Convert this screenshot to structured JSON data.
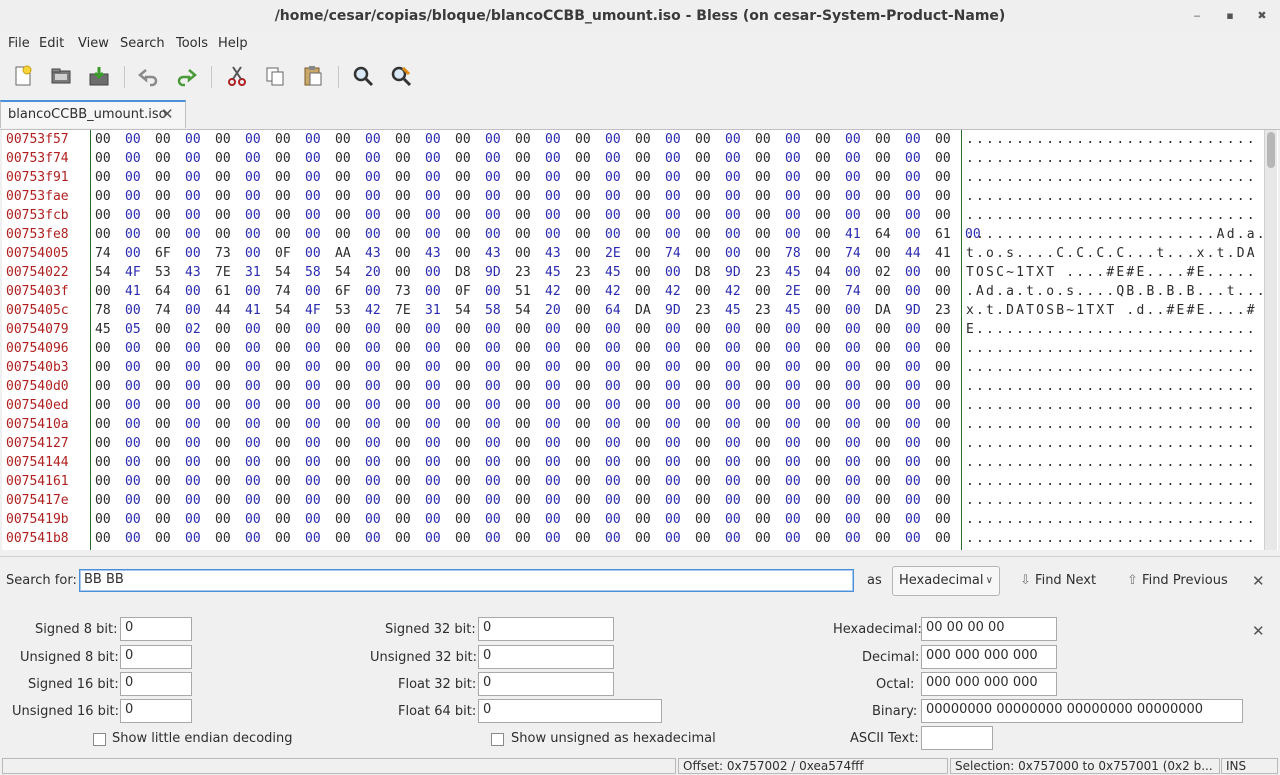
{
  "window": {
    "title": "/home/cesar/copias/bloque/blancoCCBB_umount.iso - Bless (on cesar-System-Product-Name)"
  },
  "menu": [
    "File",
    "Edit",
    "View",
    "Search",
    "Tools",
    "Help"
  ],
  "toolbar": {
    "icons": [
      "new-file-icon",
      "open-folder-icon",
      "save-icon",
      "undo-icon",
      "redo-icon",
      "cut-icon",
      "copy-icon",
      "paste-icon",
      "find-icon",
      "find-replace-icon"
    ]
  },
  "tab": {
    "label": "blancoCCBB_umount.iso"
  },
  "hex": {
    "offsets": [
      "00753f57",
      "00753f74",
      "00753f91",
      "00753fae",
      "00753fcb",
      "00753fe8",
      "00754005",
      "00754022",
      "0075403f",
      "0075405c",
      "00754079",
      "00754096",
      "007540b3",
      "007540d0",
      "007540ed",
      "0075410a",
      "00754127",
      "00754144",
      "00754161",
      "0075417e",
      "0075419b",
      "007541b8"
    ],
    "rows": [
      "00 00 00 00 00 00 00 00 00 00 00 00 00 00 00 00 00 00 00 00 00 00 00 00 00 00 00 00 00",
      "00 00 00 00 00 00 00 00 00 00 00 00 00 00 00 00 00 00 00 00 00 00 00 00 00 00 00 00 00",
      "00 00 00 00 00 00 00 00 00 00 00 00 00 00 00 00 00 00 00 00 00 00 00 00 00 00 00 00 00",
      "00 00 00 00 00 00 00 00 00 00 00 00 00 00 00 00 00 00 00 00 00 00 00 00 00 00 00 00 00",
      "00 00 00 00 00 00 00 00 00 00 00 00 00 00 00 00 00 00 00 00 00 00 00 00 00 00 00 00 00",
      "00 00 00 00 00 00 00 00 00 00 00 00 00 00 00 00 00 00 00 00 00 00 00 00 00 41 64 00 61 00",
      "74 00 6F 00 73 00 0F 00 AA 43 00 43 00 43 00 43 00 2E 00 74 00 00 00 78 00 74 00 44 41",
      "54 4F 53 43 7E 31 54 58 54 20 00 00 D8 9D 23 45 23 45 00 00 D8 9D 23 45 04 00 02 00 00",
      "00 41 64 00 61 00 74 00 6F 00 73 00 0F 00 51 42 00 42 00 42 00 42 00 2E 00 74 00 00 00",
      "78 00 74 00 44 41 54 4F 53 42 7E 31 54 58 54 20 00 64 DA 9D 23 45 23 45 00 00 DA 9D 23",
      "45 05 00 02 00 00 00 00 00 00 00 00 00 00 00 00 00 00 00 00 00 00 00 00 00 00 00 00 00",
      "00 00 00 00 00 00 00 00 00 00 00 00 00 00 00 00 00 00 00 00 00 00 00 00 00 00 00 00 00",
      "00 00 00 00 00 00 00 00 00 00 00 00 00 00 00 00 00 00 00 00 00 00 00 00 00 00 00 00 00",
      "00 00 00 00 00 00 00 00 00 00 00 00 00 00 00 00 00 00 00 00 00 00 00 00 00 00 00 00 00",
      "00 00 00 00 00 00 00 00 00 00 00 00 00 00 00 00 00 00 00 00 00 00 00 00 00 00 00 00 00",
      "00 00 00 00 00 00 00 00 00 00 00 00 00 00 00 00 00 00 00 00 00 00 00 00 00 00 00 00 00",
      "00 00 00 00 00 00 00 00 00 00 00 00 00 00 00 00 00 00 00 00 00 00 00 00 00 00 00 00 00",
      "00 00 00 00 00 00 00 00 00 00 00 00 00 00 00 00 00 00 00 00 00 00 00 00 00 00 00 00 00",
      "00 00 00 00 00 00 00 00 00 00 00 00 00 00 00 00 00 00 00 00 00 00 00 00 00 00 00 00 00",
      "00 00 00 00 00 00 00 00 00 00 00 00 00 00 00 00 00 00 00 00 00 00 00 00 00 00 00 00 00",
      "00 00 00 00 00 00 00 00 00 00 00 00 00 00 00 00 00 00 00 00 00 00 00 00 00 00 00 00 00",
      "00 00 00 00 00 00 00 00 00 00 00 00 00 00 00 00 00 00 00 00 00 00 00 00 00 00 00 00 00"
    ],
    "ascii": [
      ".............................",
      ".............................",
      ".............................",
      ".............................",
      ".............................",
      ".........................Ad.a.",
      "t.o.s....C.C.C.C...t...x.t.DA",
      "TOSC~1TXT ....#E#E....#E.....",
      ".Ad.a.t.o.s....QB.B.B.B...t...",
      "x.t.DATOSB~1TXT .d..#E#E....#",
      "E............................",
      ".............................",
      ".............................",
      ".............................",
      ".............................",
      ".............................",
      ".............................",
      ".............................",
      ".............................",
      ".............................",
      ".............................",
      "............................."
    ]
  },
  "search": {
    "label": "Search for:",
    "value": "BB BB",
    "as_label": "as",
    "mode": "Hexadecimal",
    "find_next": "Find Next",
    "find_previous": "Find Previous"
  },
  "conversion": {
    "signed8_label": "Signed 8 bit:",
    "signed8": "0",
    "unsigned8_label": "Unsigned 8 bit:",
    "unsigned8": "0",
    "signed16_label": "Signed 16 bit:",
    "signed16": "0",
    "unsigned16_label": "Unsigned 16 bit:",
    "unsigned16": "0",
    "signed32_label": "Signed 32 bit:",
    "signed32": "0",
    "unsigned32_label": "Unsigned 32 bit:",
    "unsigned32": "0",
    "float32_label": "Float 32 bit:",
    "float32": "0",
    "float64_label": "Float 64 bit:",
    "float64": "0",
    "hex_label": "Hexadecimal:",
    "hex": "00 00 00 00",
    "decimal_label": "Decimal:",
    "decimal": "000 000 000 000",
    "octal_label": "Octal:",
    "octal": "000 000 000 000",
    "binary_label": "Binary:",
    "binary": "00000000 00000000 00000000 00000000",
    "ascii_label": "ASCII Text:",
    "ascii": "",
    "little_endian_label": "Show little endian decoding",
    "unsigned_hex_label": "Show unsigned as hexadecimal"
  },
  "status": {
    "offset": "Offset: 0x757002 / 0xea574fff",
    "selection": "Selection: 0x757000 to 0x757001 (0x2 b...",
    "mode": "INS"
  }
}
